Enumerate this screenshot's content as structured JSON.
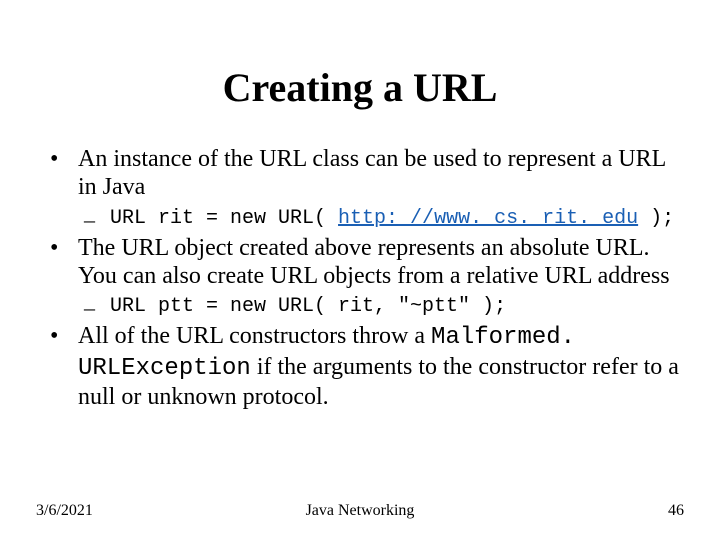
{
  "title": "Creating a URL",
  "bullets": {
    "b1": "An instance of the URL class can be used to represent a URL in Java",
    "b1_code_pre": "URL rit = new URL( ",
    "b1_code_link": "http: //www. cs. rit. edu",
    "b1_code_post": " );",
    "b2": "The URL object created above represents an absolute URL. You can also create URL objects from a relative URL address",
    "b2_code": "URL ptt = new URL( rit, \"~ptt\" );",
    "b3_pre": "All of the URL constructors throw a ",
    "b3_mono": "Malformed. URLException",
    "b3_post": " if the arguments to the constructor refer to a null or unknown protocol."
  },
  "footer": {
    "date": "3/6/2021",
    "center": "Java Networking",
    "page": "46"
  }
}
